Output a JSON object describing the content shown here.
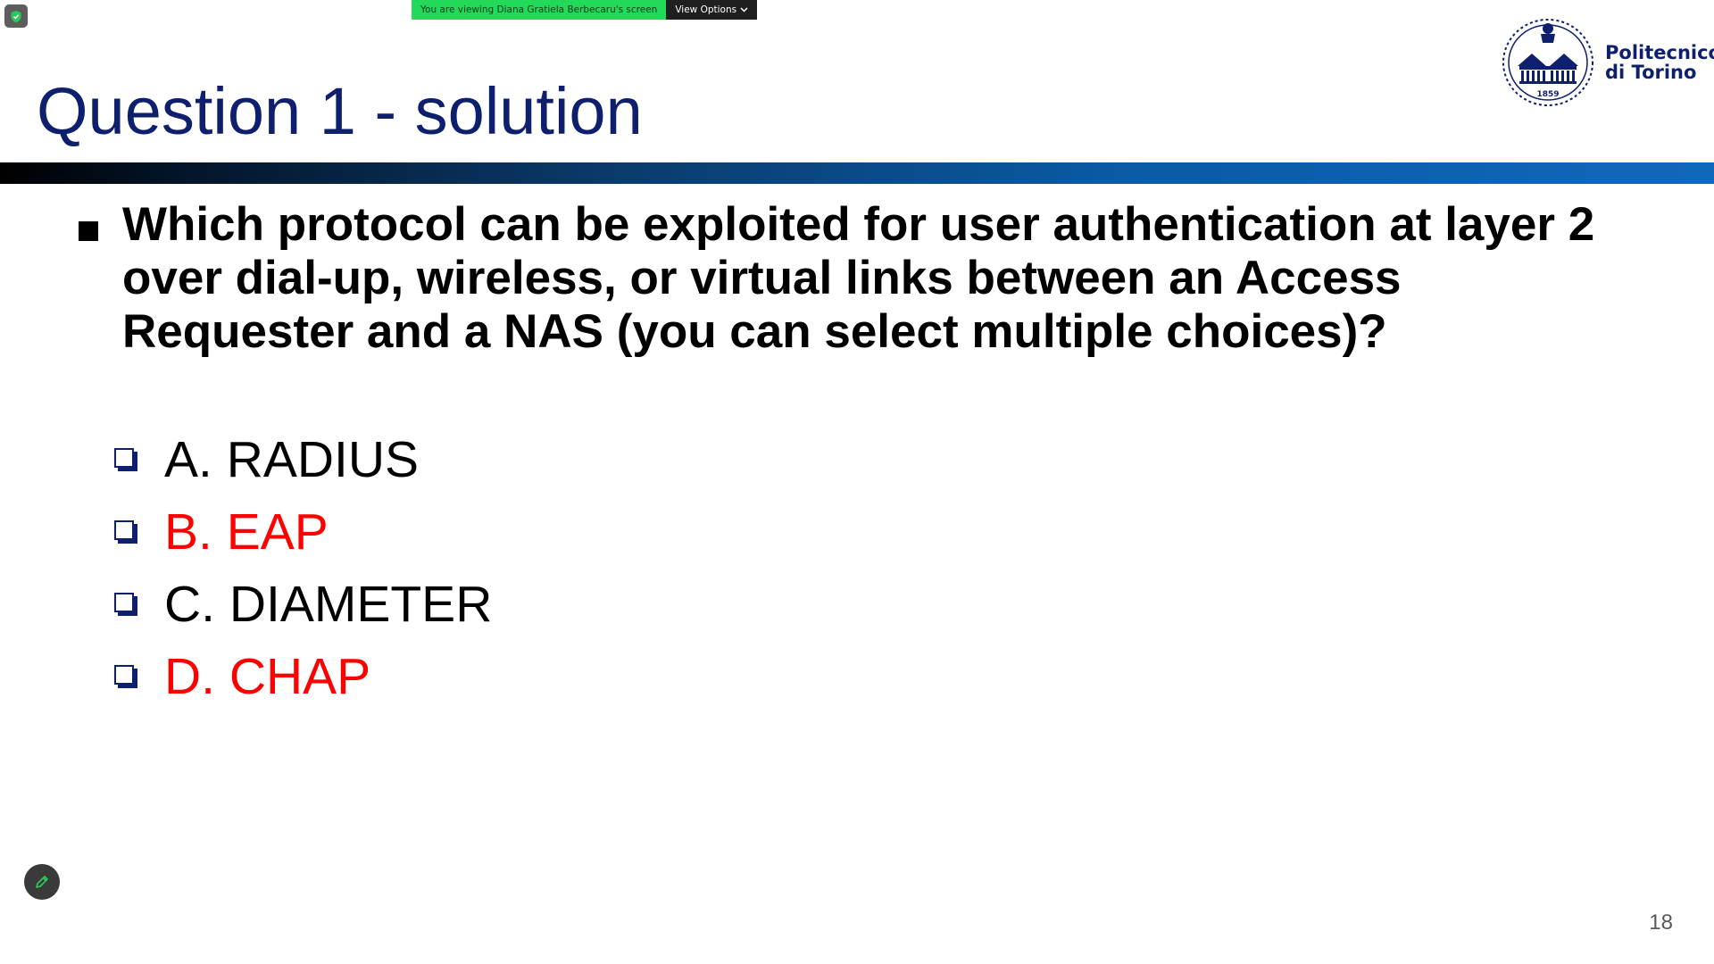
{
  "share_banner": {
    "text": "You are viewing Diana Gratiela Berbecaru's screen",
    "view_options_label": "View Options",
    "icons": {
      "security": "shield-icon",
      "dropdown": "chevron-down-icon"
    }
  },
  "slide": {
    "title": "Question 1 - solution",
    "logo": {
      "name_line1": "Politecnico",
      "name_line2": "di Torino",
      "seal_year": "1859"
    },
    "question": "Which protocol can be exploited for user authentication at layer 2 over dial-up, wireless, or virtual links between an Access Requester and a NAS (you can select multiple choices)?",
    "options": [
      {
        "label": "A. RADIUS",
        "correct": false
      },
      {
        "label": "B. EAP",
        "correct": true
      },
      {
        "label": "C. DIAMETER",
        "correct": false
      },
      {
        "label": "D. CHAP",
        "correct": true
      }
    ],
    "page_number": "18"
  },
  "annotation_tool": {
    "icon": "pencil-icon"
  },
  "colors": {
    "title_blue": "#0e1f6e",
    "correct_red": "#ff0000",
    "banner_green": "#23d959",
    "banner_dark": "#1f1f1f",
    "bar_start": "#000000",
    "bar_end": "#1068bc"
  }
}
